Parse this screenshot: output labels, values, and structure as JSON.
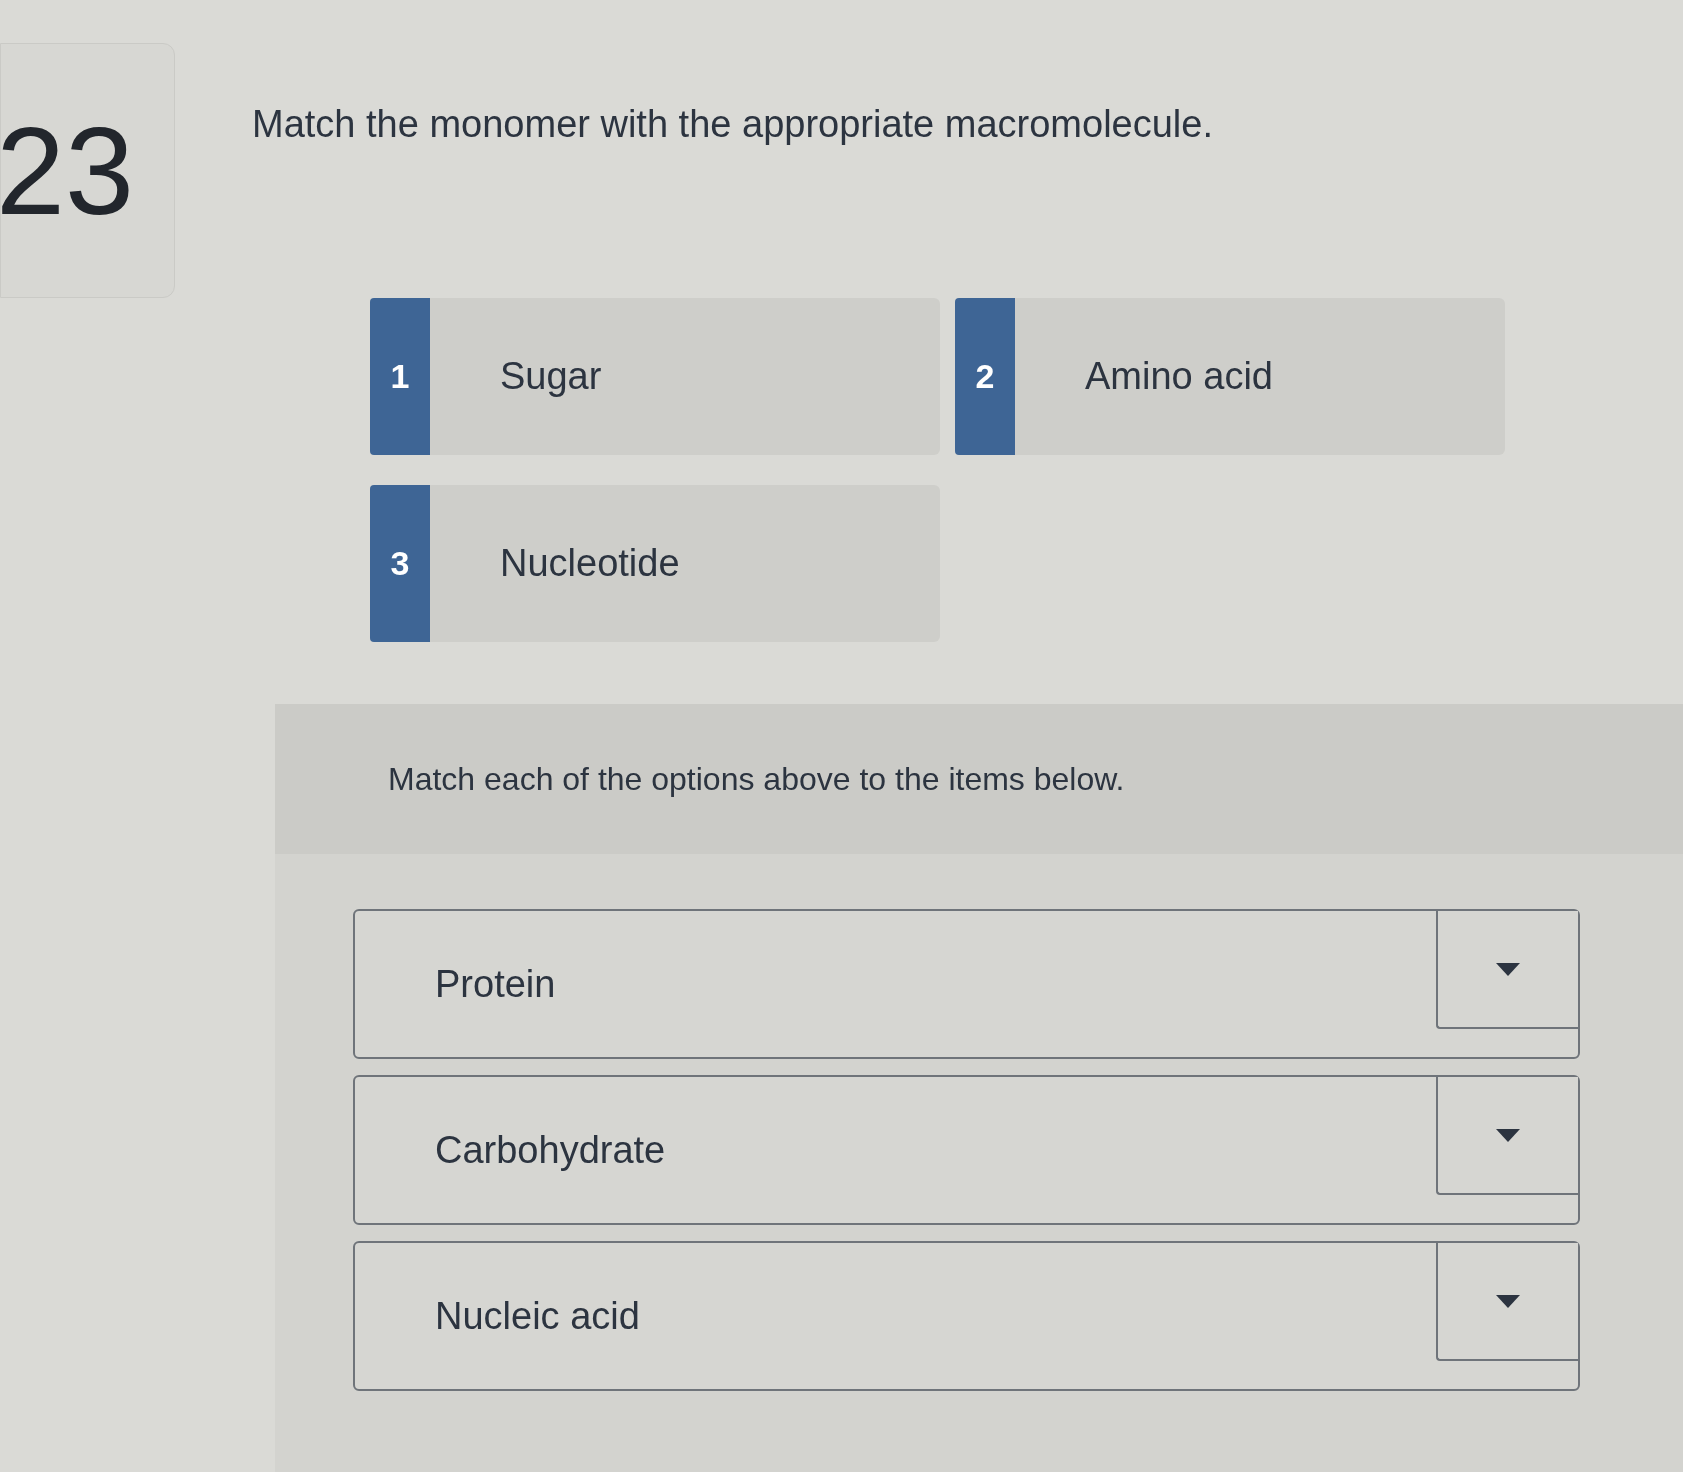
{
  "question": {
    "number": "23",
    "prompt": "Match the monomer with the appropriate macromolecule."
  },
  "options": [
    {
      "number": "1",
      "label": "Sugar"
    },
    {
      "number": "2",
      "label": "Amino acid"
    },
    {
      "number": "3",
      "label": "Nucleotide"
    }
  ],
  "matching": {
    "instruction": "Match each of the options above to the items below.",
    "items": [
      {
        "label": "Protein"
      },
      {
        "label": "Carbohydrate"
      },
      {
        "label": "Nucleic acid"
      }
    ]
  }
}
